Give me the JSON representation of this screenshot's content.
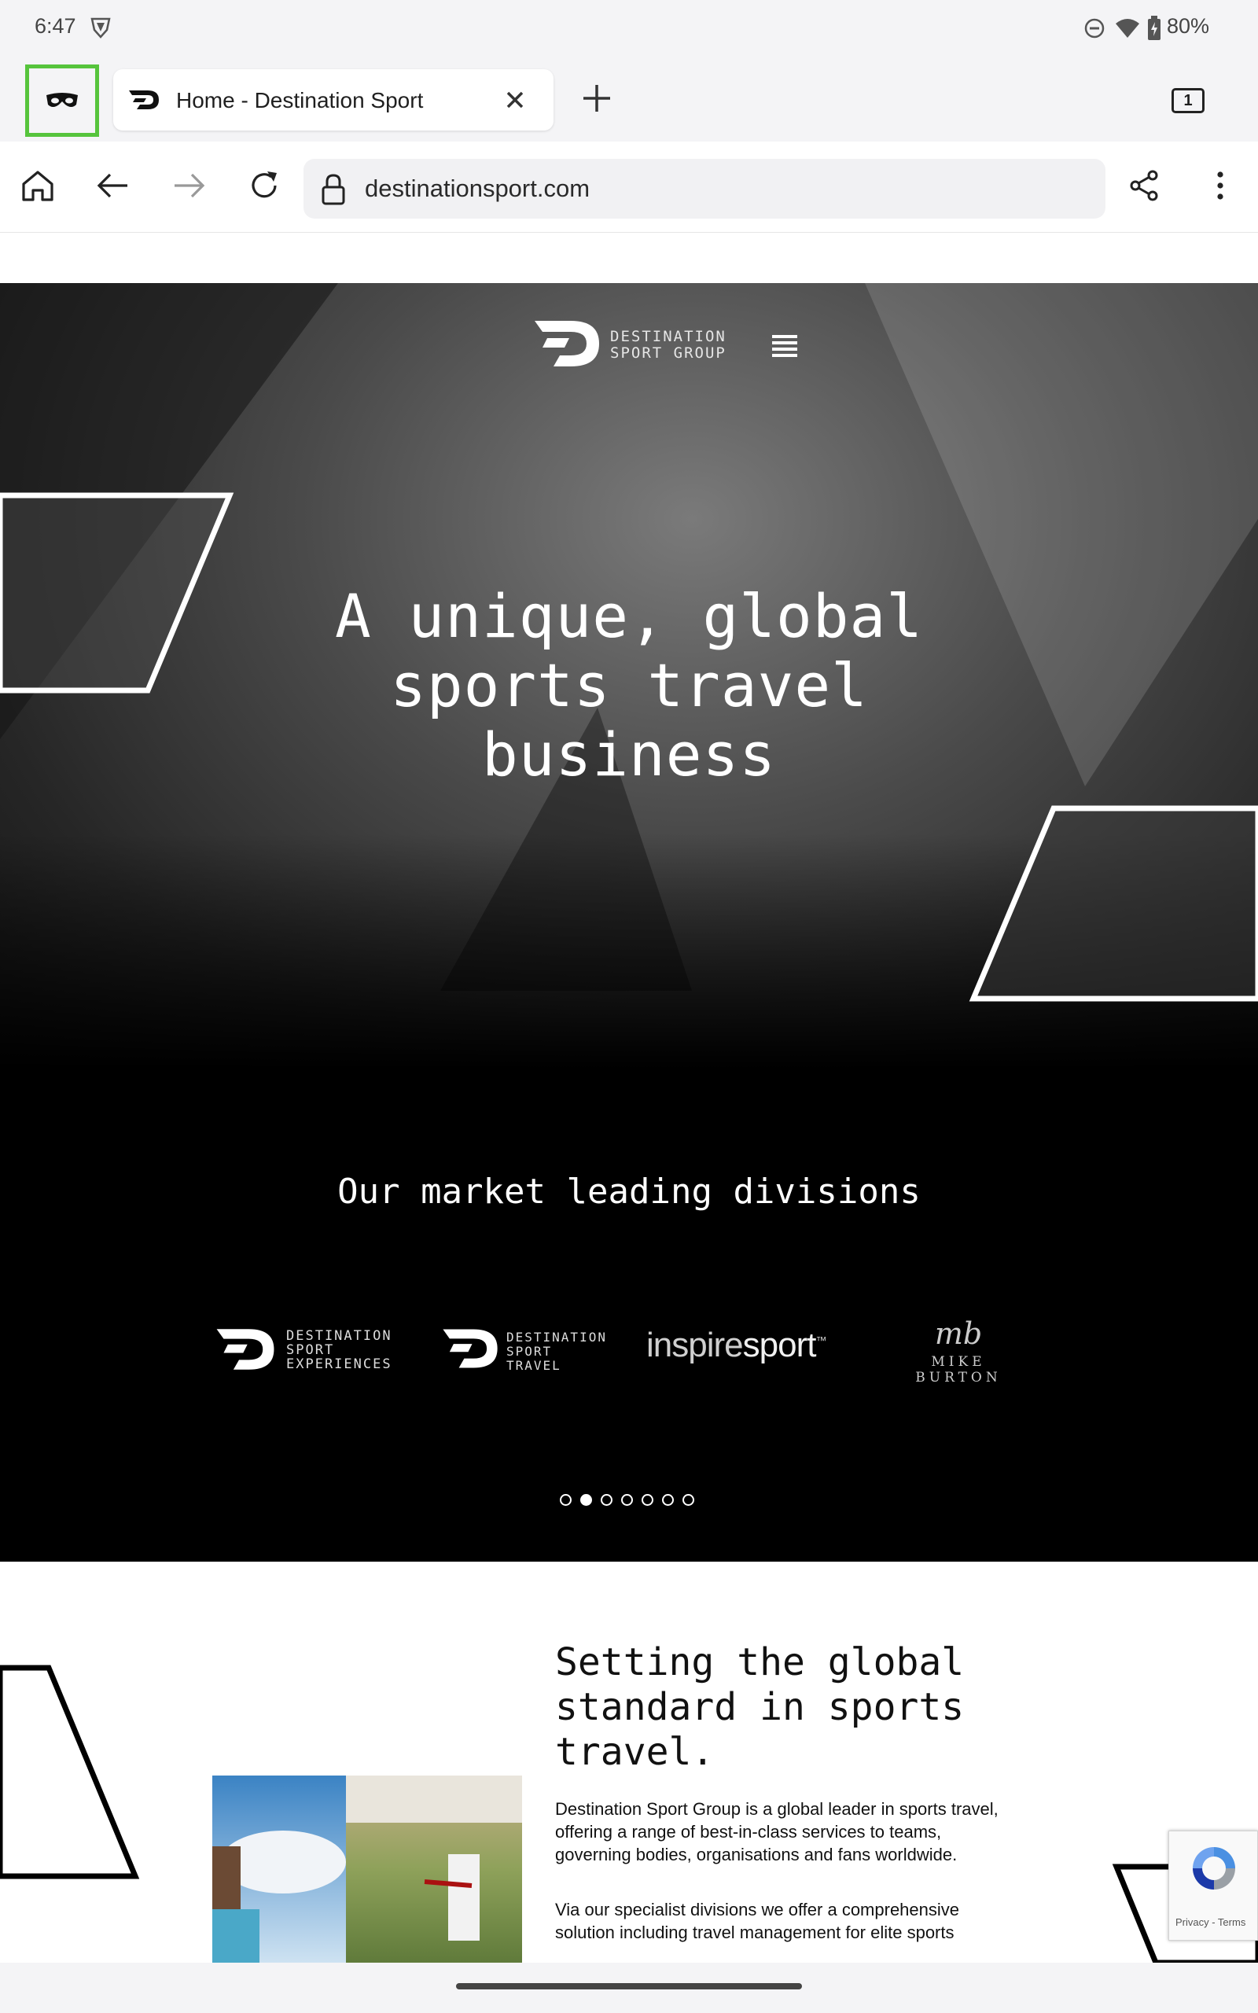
{
  "status_bar": {
    "time": "6:47",
    "battery": "80%"
  },
  "tab": {
    "title": "Home - Destination Sport"
  },
  "tab_switcher": {
    "count": "1"
  },
  "address_bar": {
    "url": "destinationsport.com"
  },
  "hero": {
    "logo_text": "DESTINATION\nSPORT GROUP",
    "headline": "A unique, global sports travel business"
  },
  "divisions": {
    "heading": "Our market leading divisions",
    "logos": [
      {
        "text": "DESTINATION\nSPORT\nEXPERIENCES"
      },
      {
        "text": "DESTINATION\nSPORT\nTRAVEL"
      },
      {
        "light": "inspire",
        "bold": "sport",
        "mark": "™"
      },
      {
        "monogram": "mb",
        "name": "MIKE BURTON"
      }
    ],
    "carousel": {
      "total": 7,
      "active": 2
    }
  },
  "about": {
    "title": "Setting the global standard in sports travel.",
    "paragraph_1": "Destination Sport Group is a global leader in sports travel, offering a range of best-in-class services to teams, governing bodies, organisations and fans worldwide.",
    "paragraph_2": "Via our specialist divisions we offer a comprehensive solution including travel management for elite sports"
  },
  "recaptcha": {
    "links": "Privacy - Terms"
  },
  "icons": {
    "status": [
      "shield-icon",
      "do-not-disturb-icon",
      "wifi-icon",
      "battery-icon"
    ],
    "toolbar": [
      "home-icon",
      "back-arrow-icon",
      "forward-arrow-icon",
      "reload-icon",
      "lock-icon",
      "share-icon",
      "more-vert-icon"
    ],
    "tabs": [
      "incognito-icon",
      "site-favicon",
      "close-icon",
      "plus-icon"
    ],
    "page": [
      "hamburger-menu-icon"
    ]
  },
  "colors": {
    "incognito_highlight": "#56c43c",
    "hero_bg": "#000000",
    "page_bg": "#ffffff"
  }
}
